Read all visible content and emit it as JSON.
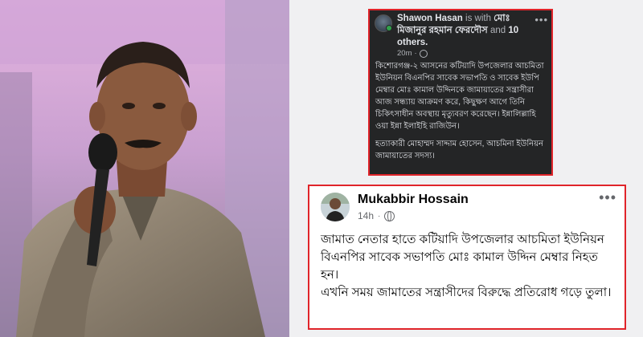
{
  "colors": {
    "highlight_border": "#e0242a",
    "dark_post_bg": "#242526",
    "light_post_bg": "#ffffff",
    "muted_text": "#b0b3b8"
  },
  "photo": {
    "icon": "speaker-photo"
  },
  "post_dark": {
    "author": "Shawon Hasan",
    "with_text": "is with",
    "tagged": "মোঃ মিজানুর রহমান ফেরদৌস",
    "and_text": "and",
    "others": "10 others.",
    "time": "20m",
    "more_icon": "more-options-icon",
    "paragraph_1": "কিশোরগঞ্জ-২ আসনের কটিয়াদি উপজেলার আচমিতা ইউনিয়ন বিএনপির সাবেক সভাপতি ও সাবেক ইউপি মেম্বার মোঃ কামাল উদ্দিনকে জামায়াতের সন্ত্রাসীরা আজ সন্ধ্যায় আক্রমণ করে, কিছুক্ষণ আগে তিনি চিকিৎসাধীন অবস্থায় মৃত্যুবরণ করেছেন। ইন্নালিল্লাহি ওয়া ইন্না ইলাইহি রাজিউন।",
    "paragraph_2": "হত্যাকারী মোহাম্মদ সাদ্দাম হোসেন, আচমিনা ইউনিয়ন জামায়াতের সদস্য।"
  },
  "post_light": {
    "author": "Mukabbir Hossain",
    "time": "14h",
    "dot": "·",
    "more_icon": "more-options-icon",
    "paragraph_1": "জামাত নেতার হাতে কটিয়াদি উপজেলার আচমিতা ইউনিয়ন বিএনপির সাবেক সভাপতি মোঃ কামাল উদ্দিন মেম্বার নিহত হন।",
    "paragraph_2": "এখনি সময় জামাতের সন্ত্রাসীদের বিরুদ্ধে প্রতিরোধ গড়ে তুলা।"
  }
}
